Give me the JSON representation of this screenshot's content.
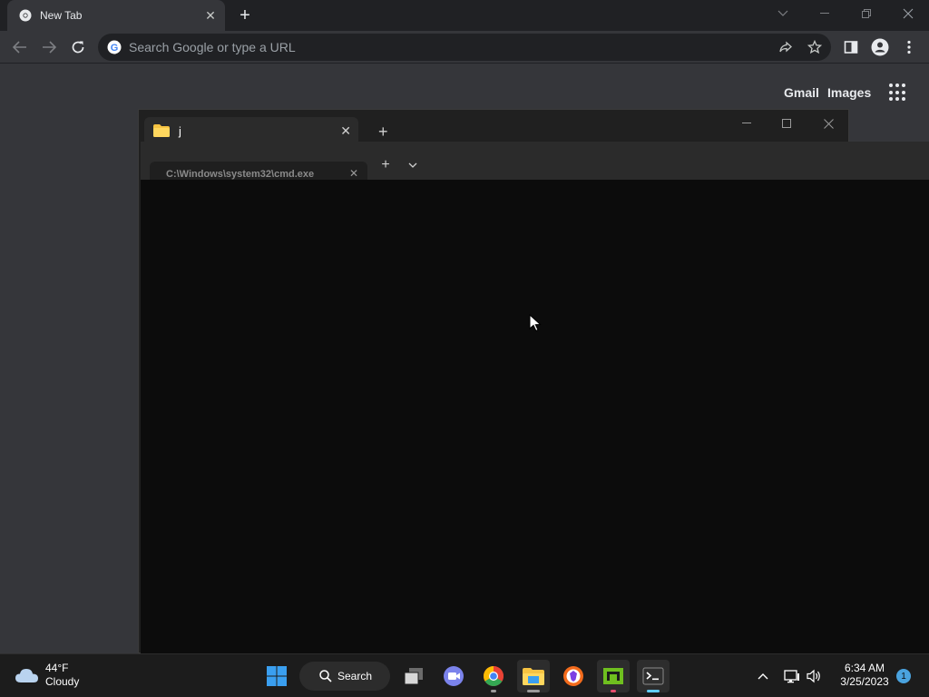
{
  "browser": {
    "tab_title": "New Tab",
    "new_tab_symbol": "+",
    "close_symbol": "✕",
    "omnibox_placeholder": "Search Google or type a URL",
    "icons": [
      "chrome-icon",
      "back-icon",
      "forward-icon",
      "reload-icon",
      "google-icon",
      "share-icon",
      "star-icon",
      "side-panel-icon",
      "profile-icon",
      "menu-icon"
    ]
  },
  "ntp": {
    "gmail_label": "Gmail",
    "images_label": "Images"
  },
  "explorer": {
    "tab_title": "j",
    "close_symbol": "✕",
    "new_tab_symbol": "+"
  },
  "terminal": {
    "tab_title": "C:\\Windows\\system32\\cmd.exe",
    "close_symbol": "✕",
    "new_tab_symbol": "+",
    "dropdown_symbol": "⌄"
  },
  "taskbar": {
    "weather_temp": "44°F",
    "weather_desc": "Cloudy",
    "search_label": "Search",
    "time": "6:34 AM",
    "date": "3/25/2023",
    "notification_count": "1",
    "colors": {
      "start_blue": "#3a9ff0",
      "chrome_red": "#e94235",
      "folder_yellow": "#f6c342",
      "accent_indicator": "#60cdff"
    }
  }
}
